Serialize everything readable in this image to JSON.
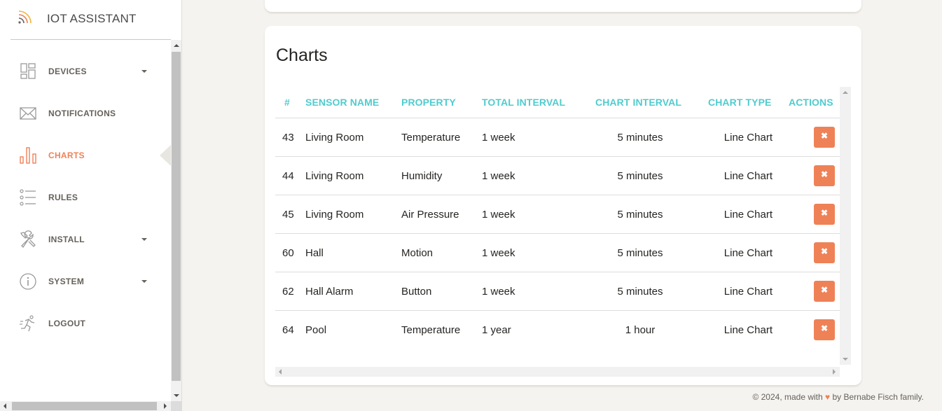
{
  "brand": {
    "title": "IOT ASSISTANT",
    "icon": "wifi-signal-icon"
  },
  "sidebar": {
    "items": [
      {
        "label": "DEVICES",
        "icon": "dashboard-grid-icon",
        "has_caret": true,
        "active": false
      },
      {
        "label": "NOTIFICATIONS",
        "icon": "envelope-icon",
        "has_caret": false,
        "active": false
      },
      {
        "label": "CHARTS",
        "icon": "bar-chart-icon",
        "has_caret": false,
        "active": true
      },
      {
        "label": "RULES",
        "icon": "list-icon",
        "has_caret": false,
        "active": false
      },
      {
        "label": "INSTALL",
        "icon": "tools-icon",
        "has_caret": true,
        "active": false
      },
      {
        "label": "SYSTEM",
        "icon": "info-circle-icon",
        "has_caret": true,
        "active": false
      },
      {
        "label": "LOGOUT",
        "icon": "running-person-icon",
        "has_caret": false,
        "active": false
      }
    ]
  },
  "main": {
    "title": "Charts",
    "table": {
      "headers": [
        "#",
        "SENSOR NAME",
        "PROPERTY",
        "TOTAL INTERVAL",
        "CHART INTERVAL",
        "CHART TYPE",
        "ACTIONS"
      ],
      "rows": [
        {
          "id": "43",
          "sensor": "Living Room",
          "property": "Temperature",
          "total": "1 week",
          "interval": "5 minutes",
          "type": "Line Chart"
        },
        {
          "id": "44",
          "sensor": "Living Room",
          "property": "Humidity",
          "total": "1 week",
          "interval": "5 minutes",
          "type": "Line Chart"
        },
        {
          "id": "45",
          "sensor": "Living Room",
          "property": "Air Pressure",
          "total": "1 week",
          "interval": "5 minutes",
          "type": "Line Chart"
        },
        {
          "id": "60",
          "sensor": "Hall",
          "property": "Motion",
          "total": "1 week",
          "interval": "5 minutes",
          "type": "Line Chart"
        },
        {
          "id": "62",
          "sensor": "Hall Alarm",
          "property": "Button",
          "total": "1 week",
          "interval": "5 minutes",
          "type": "Line Chart"
        },
        {
          "id": "64",
          "sensor": "Pool",
          "property": "Temperature",
          "total": "1 year",
          "interval": "1 hour",
          "type": "Line Chart"
        }
      ],
      "delete_icon": "close-icon",
      "delete_glyph": "✖"
    }
  },
  "footer": {
    "prefix": "© 2024, made with",
    "heart": "♥",
    "suffix": "by Bernabe Fisch family."
  },
  "colors": {
    "accent": "#ef8157",
    "header": "#51cbce",
    "background": "#f4f3ef"
  }
}
